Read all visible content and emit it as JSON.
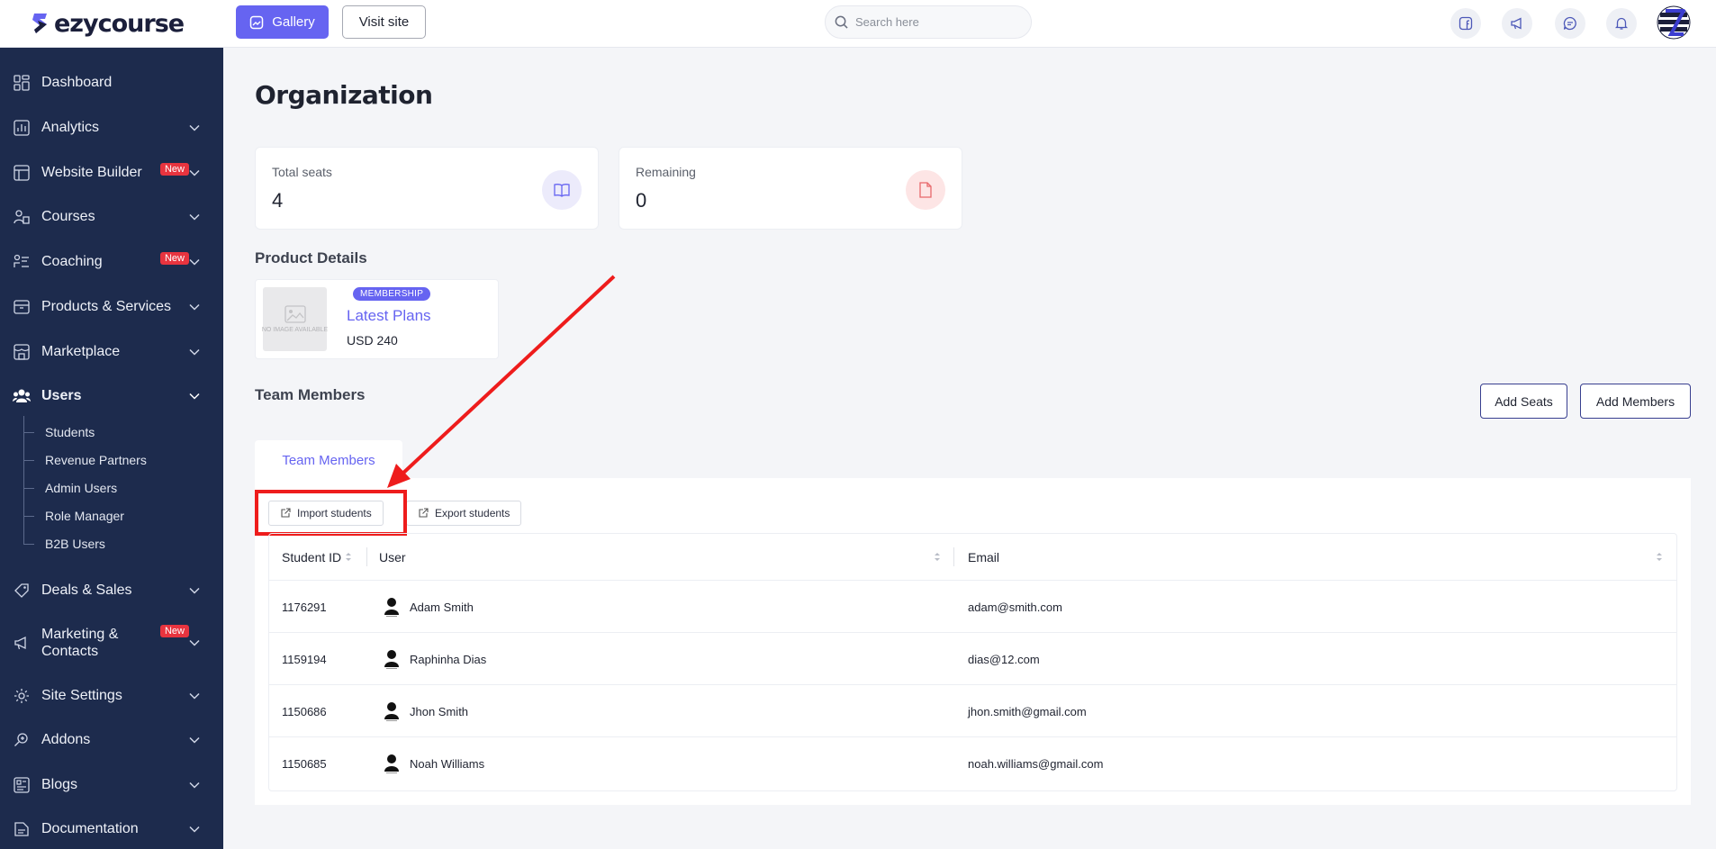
{
  "brand": {
    "name": "ezycourse"
  },
  "topbar": {
    "gallery_label": "Gallery",
    "visit_label": "Visit site",
    "search_placeholder": "Search here",
    "icons": [
      "facebook-icon",
      "megaphone-icon",
      "chat-icon",
      "bell-icon",
      "avatar"
    ]
  },
  "sidebar": {
    "items": [
      {
        "label": "Dashboard",
        "icon": "dashboard-icon"
      },
      {
        "label": "Analytics",
        "icon": "analytics-icon"
      },
      {
        "label": "Website Builder",
        "icon": "website-icon",
        "badge": "New"
      },
      {
        "label": "Courses",
        "icon": "courses-icon"
      },
      {
        "label": "Coaching",
        "icon": "coaching-icon",
        "badge": "New"
      },
      {
        "label": "Products & Services",
        "icon": "products-icon"
      },
      {
        "label": "Marketplace",
        "icon": "marketplace-icon"
      },
      {
        "label": "Users",
        "icon": "users-icon",
        "active": true
      },
      {
        "label": "Deals & Sales",
        "icon": "deals-icon"
      },
      {
        "label": "Marketing &",
        "label2": "Contacts",
        "icon": "marketing-icon",
        "badge": "New"
      },
      {
        "label": "Site Settings",
        "icon": "settings-icon"
      },
      {
        "label": "Addons",
        "icon": "addons-icon"
      },
      {
        "label": "Blogs",
        "icon": "blogs-icon"
      },
      {
        "label": "Documentation",
        "icon": "documentation-icon"
      }
    ],
    "users_sub": [
      "Students",
      "Revenue Partners",
      "Admin Users",
      "Role Manager",
      "B2B Users"
    ]
  },
  "main": {
    "title": "Organization",
    "stats": [
      {
        "label": "Total seats",
        "value": "4",
        "icon": "book-icon"
      },
      {
        "label": "Remaining",
        "value": "0",
        "icon": "file-icon"
      }
    ],
    "product_section_title": "Product Details",
    "product": {
      "badge": "MEMBERSHIP",
      "name": "Latest Plans",
      "price": "USD 240",
      "thumb_text": "NO IMAGE AVAILABLE"
    },
    "team_section_title": "Team Members",
    "add_seats_label": "Add Seats",
    "add_members_label": "Add Members",
    "tab_label": "Team Members",
    "import_label": "Import students",
    "export_label": "Export students",
    "table": {
      "headers": [
        "Student ID",
        "User",
        "Email"
      ],
      "rows": [
        {
          "id": "1176291",
          "user": "Adam Smith",
          "email": "adam@smith.com"
        },
        {
          "id": "1159194",
          "user": "Raphinha Dias",
          "email": "dias@12.com"
        },
        {
          "id": "1150686",
          "user": "Jhon Smith",
          "email": "jhon.smith@gmail.com"
        },
        {
          "id": "1150685",
          "user": "Noah Williams",
          "email": "noah.williams@gmail.com"
        }
      ]
    }
  },
  "colors": {
    "accent": "#6664f1",
    "sidebar": "#1d2b4d",
    "annotation": "#ee1c1c",
    "badge_new": "#e8343f"
  }
}
